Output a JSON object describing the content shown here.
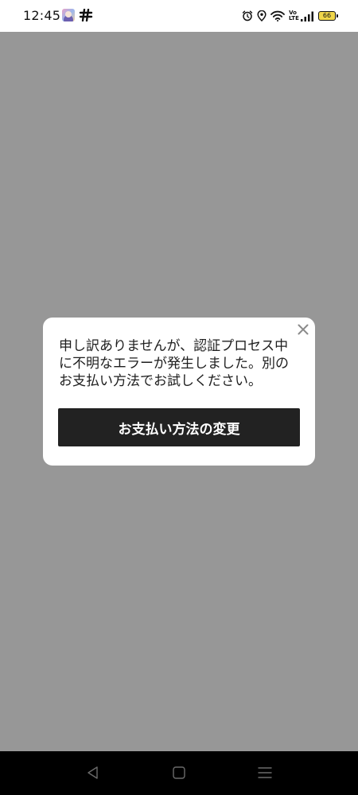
{
  "status_bar": {
    "time": "12:45",
    "battery_level": "66",
    "volte_label_top": "Vo",
    "volte_label_bottom": "LTE",
    "icons": [
      "app-avatar-icon",
      "notification-glyph-icon",
      "alarm-icon",
      "location-icon",
      "wifi-icon",
      "volte-icon",
      "signal-icon",
      "battery-icon"
    ]
  },
  "dialog": {
    "message": "申し訳ありませんが、認証プロセス中に不明なエラーが発生しました。別のお支払い方法でお試しください。",
    "button_label": "お支払い方法の変更",
    "close_icon": "close-icon"
  },
  "nav_bar": {
    "icons": [
      "back-icon",
      "home-icon",
      "menu-icon"
    ]
  },
  "colors": {
    "overlay": "#979797",
    "dialog_bg": "#ffffff",
    "button_bg": "#222222",
    "button_text": "#ffffff",
    "battery_fill": "#f0d64a",
    "nav_bg": "#000000"
  }
}
